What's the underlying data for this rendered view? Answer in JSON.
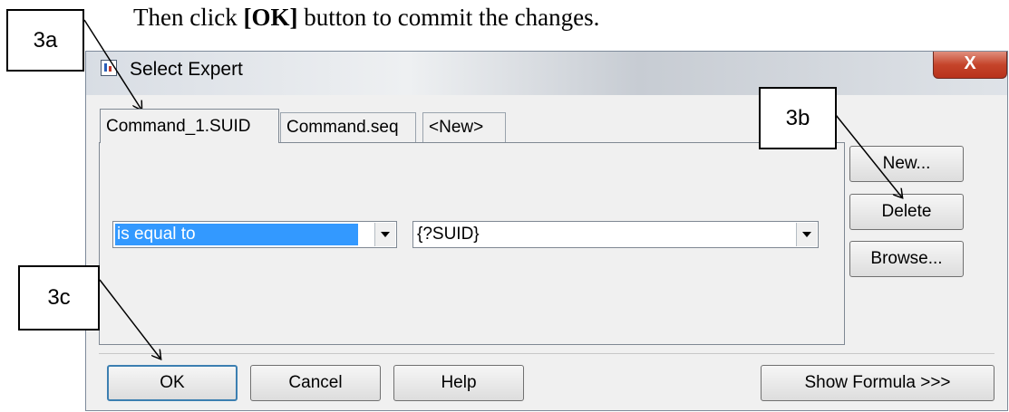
{
  "instruction": {
    "prefix": "Then click ",
    "bold": "[OK]",
    "suffix": " button to commit the changes."
  },
  "dialog": {
    "title": "Select Expert",
    "close_label": "X",
    "tabs": [
      {
        "label": "Command_1.SUID",
        "active": true
      },
      {
        "label": "Command.seq",
        "active": false
      },
      {
        "label": "<New>",
        "active": false
      }
    ],
    "condition": {
      "operator": "is equal to",
      "value": "{?SUID}"
    },
    "side_buttons": {
      "new": "New...",
      "delete": "Delete",
      "browse": "Browse..."
    },
    "bottom_buttons": {
      "ok": "OK",
      "cancel": "Cancel",
      "help": "Help",
      "show_formula": "Show Formula >>>"
    }
  },
  "annotations": {
    "a": "3a",
    "b": "3b",
    "c": "3c"
  }
}
